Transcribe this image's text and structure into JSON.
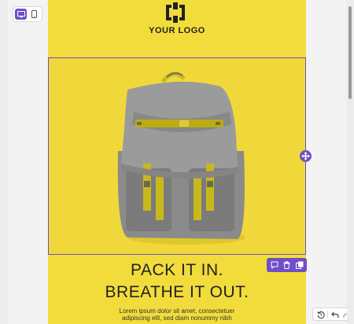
{
  "device_toggle": {
    "desktop_icon": "desktop-icon",
    "mobile_icon": "mobile-icon",
    "active": "desktop"
  },
  "canvas": {
    "logo": {
      "text": "YOUR LOGO"
    },
    "image": {
      "subject": "backpack-photo"
    },
    "headline": {
      "line1": "PACK IT IN.",
      "line2": "BREATHE IT OUT."
    },
    "body": {
      "line1": "Lorem ipsum dolor sit amet, consectetuer",
      "line2": "adipiscing elit, sed diam nonummy nibh"
    }
  },
  "element_toolbar": {
    "items": [
      "comment-icon",
      "trash-icon",
      "duplicate-icon"
    ]
  },
  "history_controls": {
    "items": [
      "history-icon",
      "undo-icon",
      "redo-icon"
    ]
  },
  "colors": {
    "accent": "#6e4fc7",
    "canvas_background": "#f2dc3c",
    "text": "#222222"
  }
}
